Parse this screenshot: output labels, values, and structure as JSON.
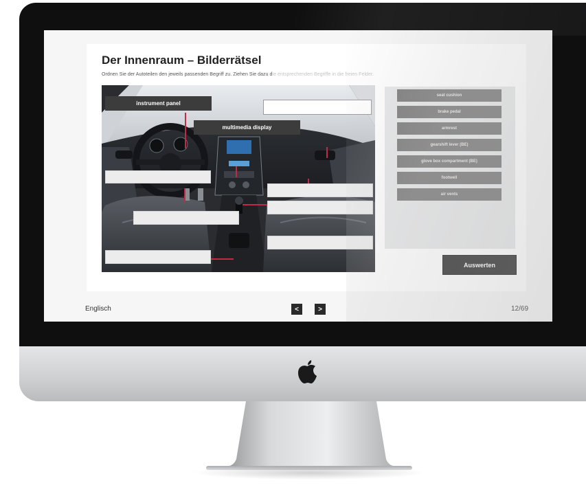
{
  "quiz": {
    "title": "Der Innenraum – Bilderrätsel",
    "instruction": "Ordnen Sie der Autoteilen den jeweils passenden Begriff zu. Ziehen Sie dazu d",
    "instruction_faded": "ie entsprechenden Begriffe in die freien Felder.",
    "placed_labels": [
      {
        "text": "instrument panel"
      },
      {
        "text": "multimedia display"
      }
    ],
    "word_bank": [
      "seat cushion",
      "brake pedal",
      "armrest",
      "gearshift lever (BE)",
      "glove box compartment (BE)",
      "footwell",
      "air vents"
    ],
    "evaluate_label": "Auswerten"
  },
  "footer": {
    "language": "Englisch",
    "prev_symbol": "<",
    "next_symbol": ">",
    "page": "12/69"
  },
  "colors": {
    "accent_line": "#c02c48",
    "dark_button": "#2f2f2f",
    "chip": "#7a7a7a",
    "bezel": "#0f0f10"
  }
}
